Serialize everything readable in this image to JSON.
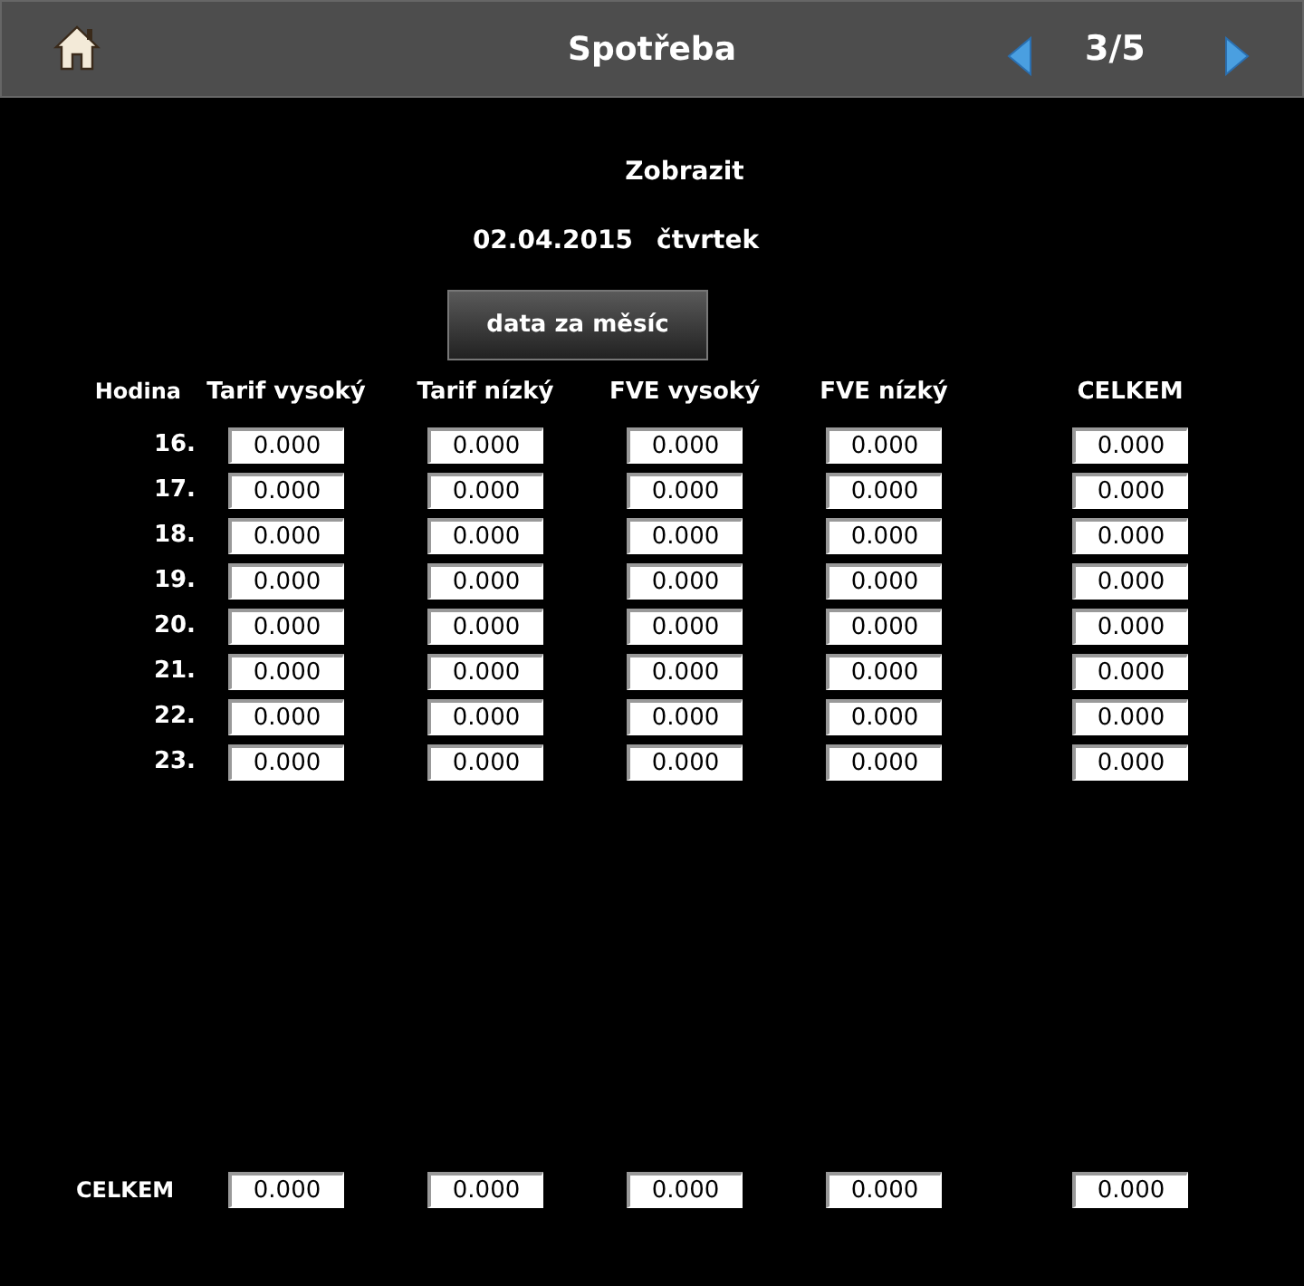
{
  "header": {
    "title": "Spotřeba",
    "page": "3/5"
  },
  "show_label": "Zobrazit",
  "date": "02.04.2015",
  "weekday": "čtvrtek",
  "month_button": "data za měsíc",
  "table": {
    "columns": [
      "Hodina",
      "Tarif vysoký",
      "Tarif nízký",
      "FVE vysoký",
      "FVE nízký",
      "CELKEM"
    ],
    "rows": [
      {
        "hour": "16.",
        "values": [
          "0.000",
          "0.000",
          "0.000",
          "0.000",
          "0.000"
        ]
      },
      {
        "hour": "17.",
        "values": [
          "0.000",
          "0.000",
          "0.000",
          "0.000",
          "0.000"
        ]
      },
      {
        "hour": "18.",
        "values": [
          "0.000",
          "0.000",
          "0.000",
          "0.000",
          "0.000"
        ]
      },
      {
        "hour": "19.",
        "values": [
          "0.000",
          "0.000",
          "0.000",
          "0.000",
          "0.000"
        ]
      },
      {
        "hour": "20.",
        "values": [
          "0.000",
          "0.000",
          "0.000",
          "0.000",
          "0.000"
        ]
      },
      {
        "hour": "21.",
        "values": [
          "0.000",
          "0.000",
          "0.000",
          "0.000",
          "0.000"
        ]
      },
      {
        "hour": "22.",
        "values": [
          "0.000",
          "0.000",
          "0.000",
          "0.000",
          "0.000"
        ]
      },
      {
        "hour": "23.",
        "values": [
          "0.000",
          "0.000",
          "0.000",
          "0.000",
          "0.000"
        ]
      }
    ],
    "total": {
      "label": "CELKEM",
      "values": [
        "0.000",
        "0.000",
        "0.000",
        "0.000",
        "0.000"
      ]
    }
  }
}
